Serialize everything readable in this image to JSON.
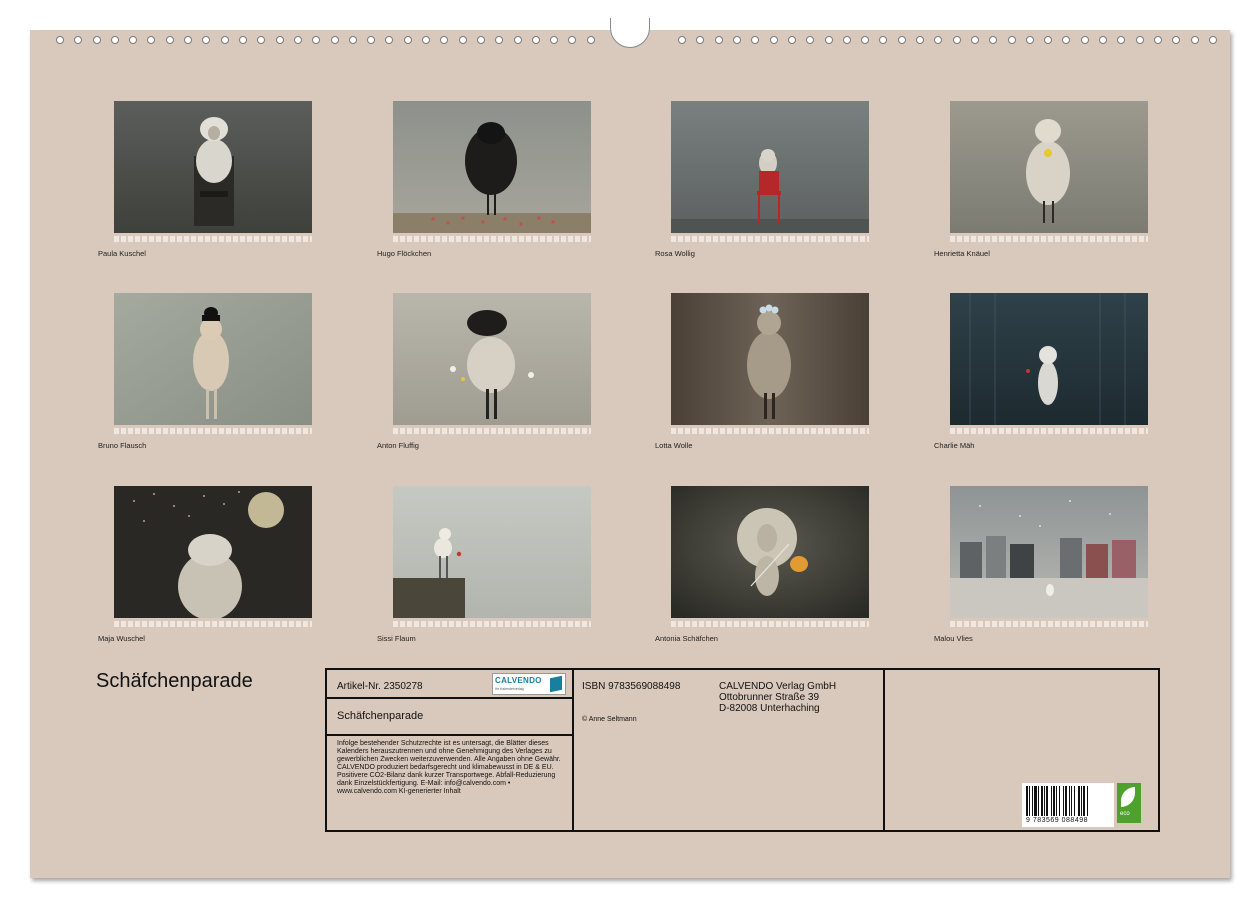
{
  "calendar": {
    "title": "Schäfchenparade",
    "images": [
      {
        "caption": "Paula Kuschel"
      },
      {
        "caption": "Hugo Flöckchen"
      },
      {
        "caption": "Rosa Wollig"
      },
      {
        "caption": "Henrietta Knäuel"
      },
      {
        "caption": "Bruno Flausch"
      },
      {
        "caption": "Anton Fluffig"
      },
      {
        "caption": "Lotta Wolle"
      },
      {
        "caption": "Charlie Mäh"
      },
      {
        "caption": "Maja Wuschel"
      },
      {
        "caption": "Sissi Flaum"
      },
      {
        "caption": "Antonia Schäfchen"
      },
      {
        "caption": "Malou Vlies"
      }
    ]
  },
  "info": {
    "article": "Artikel-Nr. 2350278",
    "logo_text": "CALVENDO",
    "logo_sub": "Ihr Kalenderverlag",
    "title": "Schäfchenparade",
    "legal": "Infolge bestehender Schutzrechte ist es untersagt, die Blätter dieses Kalenders herauszutrennen und ohne Genehmigung des Verlages zu gewerblichen Zwecken weiterzuverwenden. Alle Angaben ohne Gewähr. CALVENDO produziert bedarfsgerecht und klimabewusst in DE & EU. Positivere CO2-Bilanz dank kurzer Transportwege. Abfall-Reduzierung dank Einzelstückfertigung. E-Mail: info@calvendo.com • www.calvendo.com KI-generierter Inhalt",
    "isbn": "ISBN 9783569088498",
    "copyright": "© Anne Seltmann",
    "publisher_line1": "CALVENDO Verlag GmbH",
    "publisher_line2": "Ottobrunner Straße 39",
    "publisher_line3": "D-82008 Unterhaching",
    "barcode_number": "9 783569 088498",
    "eco_label": "eco"
  }
}
